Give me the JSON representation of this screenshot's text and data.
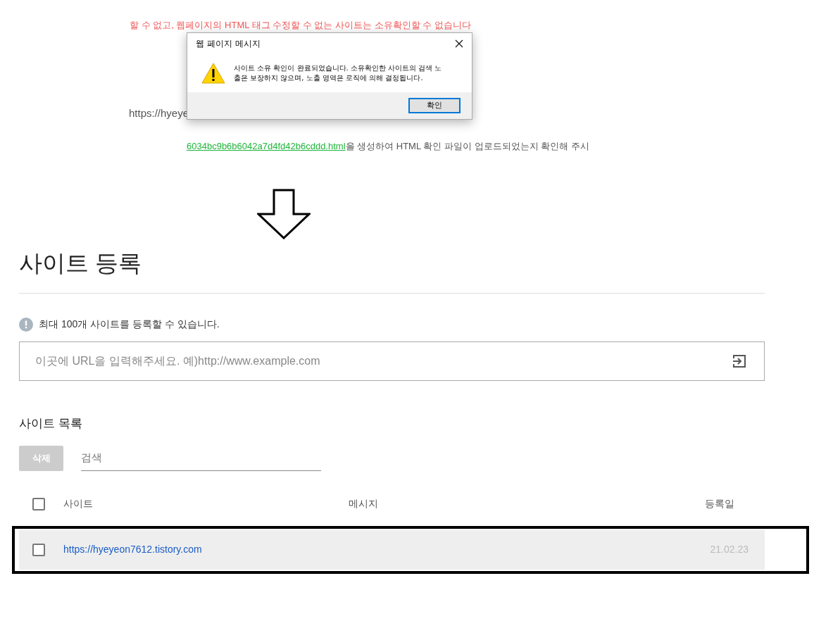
{
  "background_page": {
    "notice": "할 수 없고, 웹페이지의 HTML 태그 수정할 수 없는 사이트는 소유확인할 수 없습니다",
    "url": "https://hyeye",
    "file_name": "6034bc9b6b6042a7d4fd42b6cddd.html",
    "instruction": "을 생성하여 HTML 확인 파일이 업로드되었는지 확인해 주시"
  },
  "dialog": {
    "title": "웹 페이지 메시지",
    "message": "사이트 소유 확인이 완료되었습니다. 소유확인한 사이트의 검색 노출은 보장하지 않으며, 노출 영역은 로직에 의해 결정됩니다.",
    "button": "확인"
  },
  "page": {
    "title": "사이트 등록",
    "info": "최대 100개 사이트를 등록할 수 있습니다.",
    "url_input": {
      "placeholder": "이곳에 URL을 입력해주세요. 예)http://www.example.com"
    },
    "list_title": "사이트 목록",
    "delete_button": {
      "label": "삭제",
      "disabled": true
    },
    "search": {
      "placeholder": "검색"
    },
    "table": {
      "columns": [
        "사이트",
        "메시지",
        "등록일"
      ],
      "header_checked": false,
      "rows": [
        {
          "site": "https://hyeyeon7612.tistory.com",
          "message": "",
          "date": "21.02.23",
          "checked": false,
          "highlighted": true
        }
      ]
    }
  }
}
